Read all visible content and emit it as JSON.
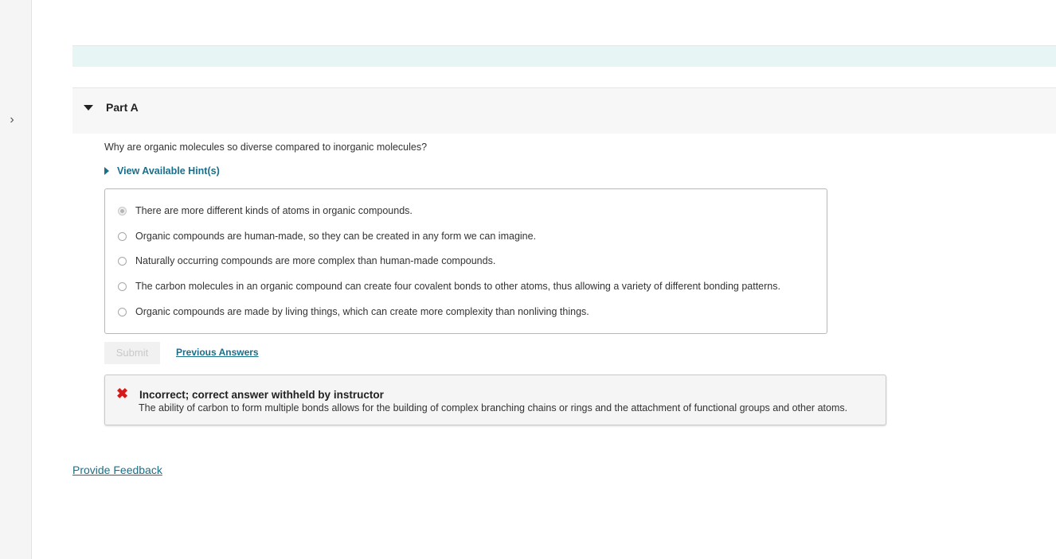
{
  "sidebar": {
    "toggle_glyph": "›",
    "toggle_icon": "chevron-right-icon"
  },
  "part": {
    "title": "Part A"
  },
  "question": {
    "text": "Why are organic molecules so diverse compared to inorganic molecules?"
  },
  "hints": {
    "label": "View Available Hint(s)"
  },
  "options": [
    {
      "label": "There are more different kinds of atoms in organic compounds.",
      "selected": true
    },
    {
      "label": "Organic compounds are human-made, so they can be created in any form we can imagine.",
      "selected": false
    },
    {
      "label": "Naturally occurring compounds are more complex than human-made compounds.",
      "selected": false
    },
    {
      "label": "The carbon molecules in an organic compound can create four covalent bonds to other atoms, thus allowing a variety of different bonding patterns.",
      "selected": false
    },
    {
      "label": "Organic compounds are made by living things, which can create more complexity than nonliving things.",
      "selected": false
    }
  ],
  "actions": {
    "submit_label": "Submit",
    "previous_answers_label": "Previous Answers"
  },
  "feedback": {
    "icon": "x-icon",
    "icon_glyph": "✖",
    "title": "Incorrect; correct answer withheld by instructor",
    "text": "The ability of carbon to form multiple bonds allows for the building of complex branching chains or rings and the attachment of functional groups and other atoms."
  },
  "footer": {
    "provide_feedback_label": "Provide Feedback"
  },
  "colors": {
    "link": "#1a6e8a",
    "error": "#d41a1a",
    "banner": "#e8f5f5"
  }
}
